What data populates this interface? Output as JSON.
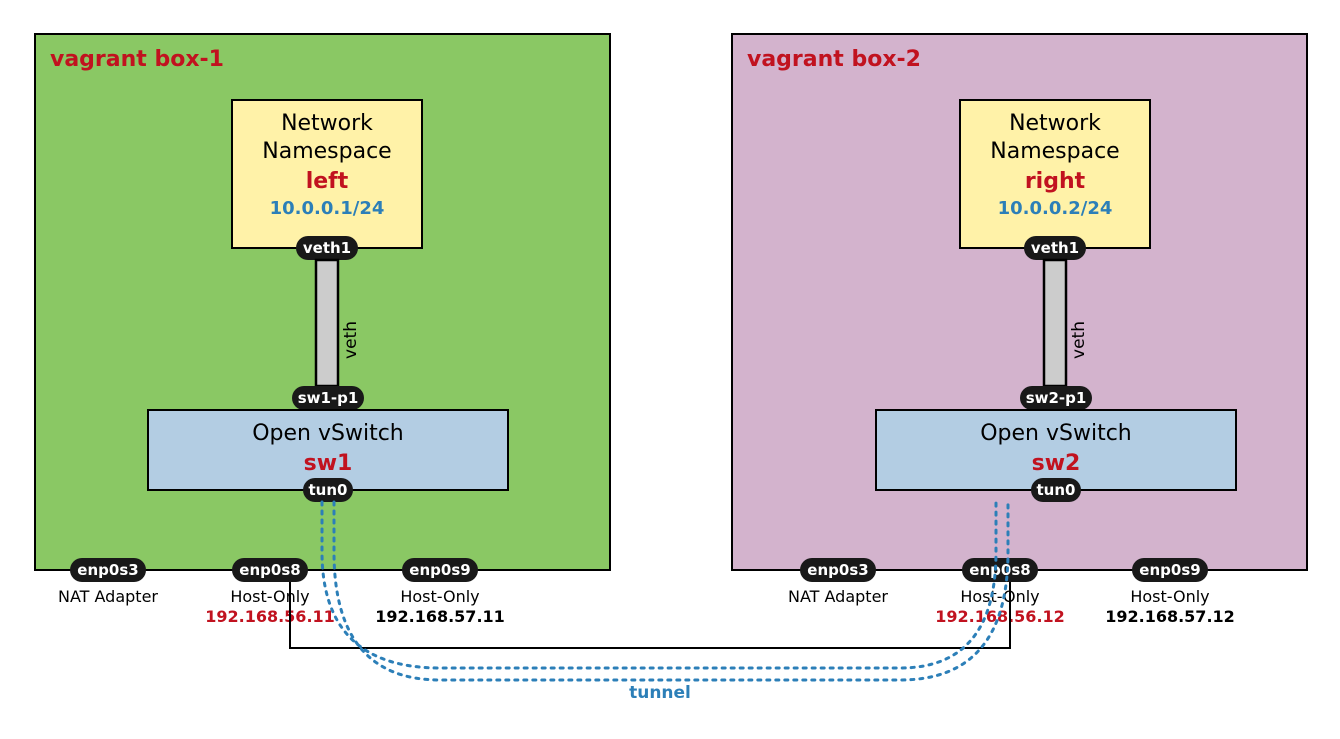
{
  "boxes": [
    {
      "title": "vagrant box-1",
      "ns": {
        "lines": [
          "Network",
          "Namespace"
        ],
        "name": "left",
        "ip": "10.0.0.1/24",
        "veth_pill": "veth1"
      },
      "veth_link_label": "veth",
      "switch": {
        "top_pill": "sw1-p1",
        "title": "Open vSwitch",
        "name": "sw1",
        "bottom_pill": "tun0"
      },
      "interfaces": [
        {
          "pill": "enp0s3",
          "label": "NAT Adapter",
          "ip": "",
          "highlight": false
        },
        {
          "pill": "enp0s8",
          "label": "Host-Only",
          "ip": "192.168.56.11",
          "highlight": true
        },
        {
          "pill": "enp0s9",
          "label": "Host-Only",
          "ip": "192.168.57.11",
          "highlight": false
        }
      ]
    },
    {
      "title": "vagrant box-2",
      "ns": {
        "lines": [
          "Network",
          "Namespace"
        ],
        "name": "right",
        "ip": "10.0.0.2/24",
        "veth_pill": "veth1"
      },
      "veth_link_label": "veth",
      "switch": {
        "top_pill": "sw2-p1",
        "title": "Open vSwitch",
        "name": "sw2",
        "bottom_pill": "tun0"
      },
      "interfaces": [
        {
          "pill": "enp0s3",
          "label": "NAT Adapter",
          "ip": "",
          "highlight": false
        },
        {
          "pill": "enp0s8",
          "label": "Host-Only",
          "ip": "192.168.56.12",
          "highlight": true
        },
        {
          "pill": "enp0s9",
          "label": "Host-Only",
          "ip": "192.168.57.12",
          "highlight": false
        }
      ]
    }
  ],
  "tunnel_label": "tunnel",
  "colors": {
    "box_left": "#8ac864",
    "box_right": "#d3b3cd",
    "ns": "#fff2a8",
    "switch": "#b3cde3",
    "pill": "#191919",
    "tunnel": "#2c7fb8"
  }
}
